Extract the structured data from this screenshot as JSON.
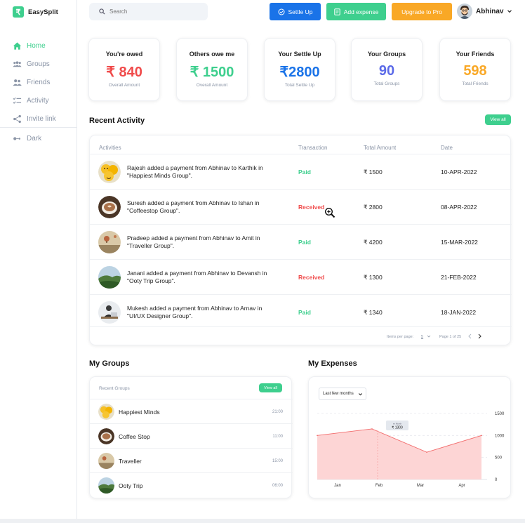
{
  "app": {
    "name": "EasySplit",
    "logo_glyph": "₹"
  },
  "colors": {
    "green": "#3ecf8e",
    "blue": "#1a73e8",
    "orange": "#f9a826",
    "red": "#f04b4b",
    "purple": "#5b6ae8",
    "muted": "#8a94a6"
  },
  "sidebar": {
    "items": [
      {
        "label": "Home",
        "icon": "home-icon",
        "active": true
      },
      {
        "label": "Groups",
        "icon": "groups-icon",
        "active": false
      },
      {
        "label": "Friends",
        "icon": "friends-icon",
        "active": false
      },
      {
        "label": "Activity",
        "icon": "activity-icon",
        "active": false
      },
      {
        "label": "Invite link",
        "icon": "share-icon",
        "active": false
      }
    ],
    "dark_label": "Dark"
  },
  "topbar": {
    "search_placeholder": "Search",
    "settle_up": "Settle Up",
    "add_expense": "Add expense",
    "upgrade": "Upgrade to Pro",
    "user_name": "Abhinav"
  },
  "stats": [
    {
      "title": "You're owed",
      "value": "₹ 840",
      "sub": "Overall Amount",
      "color": "#f04b4b"
    },
    {
      "title": "Others owe me",
      "value": "₹ 1500",
      "sub": "Overall Amount",
      "color": "#3ecf8e"
    },
    {
      "title": "Your Settle Up",
      "value": "₹2800",
      "sub": "Total Settle Up",
      "color": "#1a73e8"
    },
    {
      "title": "Your Groups",
      "value": "90",
      "sub": "Total Groups",
      "color": "#5b6ae8"
    },
    {
      "title": "Your Friends",
      "value": "598",
      "sub": "Total Friends",
      "color": "#f9a826"
    }
  ],
  "recent_activity": {
    "title": "Recent Activity",
    "view_all": "View all",
    "columns": [
      "Activities",
      "Transaction",
      "Total Amount",
      "Date"
    ],
    "rows": [
      {
        "text": "Rajesh added a payment from Abhinav to Karthik in \"Happiest Minds Group\".",
        "status": "Paid",
        "amount": "₹ 1500",
        "date": "10-APR-2022",
        "avatar": "emoji"
      },
      {
        "text": "Suresh added a payment from Abhinav to Ishan in \"Coffeestop Group\".",
        "status": "Received",
        "amount": "₹ 2800",
        "date": "08-APR-2022",
        "avatar": "coffee"
      },
      {
        "text": "Pradeep added a payment from Abhinav to Amit in \"Traveller Group\".",
        "status": "Paid",
        "amount": "₹ 4200",
        "date": "15-MAR-2022",
        "avatar": "balloon"
      },
      {
        "text": "Janani added a payment from Abhinav to Devansh in \"Ooty Trip Group\".",
        "status": "Received",
        "amount": "₹ 1300",
        "date": "21-FEB-2022",
        "avatar": "hills"
      },
      {
        "text": "Mukesh added a payment from Abhinav to Arnav in \"UI/UX Designer Group\".",
        "status": "Paid",
        "amount": "₹ 1340",
        "date": "18-JAN-2022",
        "avatar": "desk"
      }
    ],
    "pager": {
      "items_label": "Items per page:",
      "items_value": "5",
      "range": "Page 1 of 25"
    }
  },
  "my_groups": {
    "title": "My Groups",
    "header": "Recent Groups",
    "view_all": "View all",
    "items": [
      {
        "name": "Happiest Minds",
        "time": "21:00",
        "avatar": "emoji"
      },
      {
        "name": "Coffee Stop",
        "time": "11:00",
        "avatar": "coffee"
      },
      {
        "name": "Traveller",
        "time": "15:00",
        "avatar": "balloon"
      },
      {
        "name": "Ooty Trip",
        "time": "06:00",
        "avatar": "hills"
      }
    ]
  },
  "my_expenses": {
    "title": "My Expenses",
    "range_select": "Last few months",
    "tooltip_label": "ex Month",
    "tooltip_value": "₹ 1300"
  },
  "chart_data": {
    "type": "area",
    "categories": [
      "Jan",
      "Feb",
      "Mar",
      "Apr"
    ],
    "series": [
      {
        "values": [
          1000,
          1150,
          620,
          1000
        ]
      }
    ],
    "yticks": [
      "0",
      "500",
      "1000",
      "1500"
    ],
    "ylim": [
      0,
      1500
    ],
    "grid": true,
    "fill_color": "#fdd5d5",
    "line_color": "#f26b6b"
  }
}
